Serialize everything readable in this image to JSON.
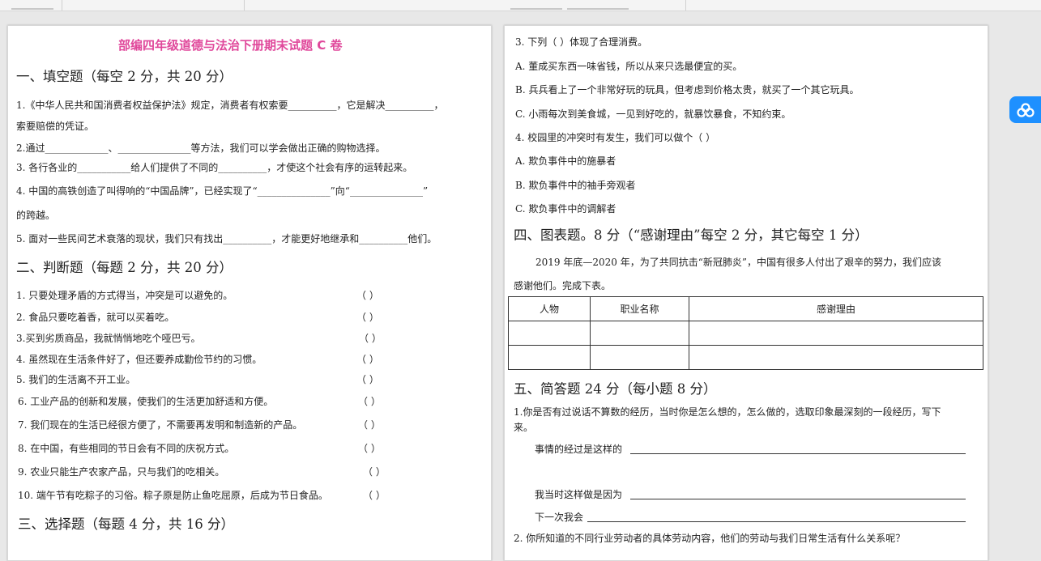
{
  "left": {
    "title": "部编四年级道德与法治下册期末试题 C 卷",
    "s1_heading": "一、填空题（每空 2 分，共 20 分）",
    "fill": [
      "1.《中华人民共和国消费者权益保护法》规定，消费者有权索要__________，它是解决__________，",
      "索要赔偿的凭证。",
      "2.通过_____________、_______________等方法，我们可以学会做出正确的购物选择。",
      "3. 各行各业的___________给人们提供了不同的__________，才使这个社会有序的运转起来。",
      "4. 中国的高铁创造了叫得响的“中国品牌”，已经实现了“_______________”向“_______________”",
      "的跨越。",
      "5. 面对一些民间艺术衰落的现状，我们只有找出__________，才能更好地继承和__________他们。"
    ],
    "s2_heading": "二、判断题（每题 2 分，共 20 分）",
    "judge": [
      {
        "text": "1. 只要处理矛盾的方式得当，冲突是可以避免的。",
        "paren": "（     ）"
      },
      {
        "text": "2. 食品只要吃着香，就可以买着吃。",
        "paren": "（     ）"
      },
      {
        "text": "3.买到劣质商品，我就悄悄地吃个哑巴亏。",
        "paren": "（     ）"
      },
      {
        "text": "4. 虽然现在生活条件好了，但还要养成勤俭节约的习惯。",
        "paren": "（     ）"
      },
      {
        "text": "5. 我们的生活离不开工业。",
        "paren": "（     ）"
      },
      {
        "text": "6. 工业产品的创新和发展，使我们的生活更加舒适和方便。",
        "paren": "（     ）"
      },
      {
        "text": "7. 我们现在的生活已经很方便了，不需要再发明和制造新的产品。",
        "paren": "（     ）"
      },
      {
        "text": "8. 在中国，有些相同的节日会有不同的庆祝方式。",
        "paren": "（     ）"
      },
      {
        "text": "9. 农业只能生产农家产品，只与我们的吃相关。",
        "paren": "（     ）"
      },
      {
        "text": "10. 端午节有吃粽子的习俗。粽子原是防止鱼吃屈原，后成为节日食品。",
        "paren": "（     ）"
      }
    ],
    "s3_heading": "三、选择题（每题 4 分，共 16 分）"
  },
  "right": {
    "choice_lines": [
      "3. 下列（     ）体现了合理消费。",
      "A. 董成买东西一味省钱，所以从来只选最便宜的买。",
      "B. 兵兵看上了一个非常好玩的玩具，但考虑到价格太贵，就买了一个其它玩具。",
      "C. 小雨每次到美食城，一见到好吃的，就暴饮暴食，不知约束。",
      "4. 校园里的冲突时有发生，我们可以做个（     ）",
      "A. 欺负事件中的施暴者",
      "B. 欺负事件中的袖手旁观者",
      "C. 欺负事件中的调解者"
    ],
    "s4_heading": "四、图表题。8 分（“感谢理由”每空 2 分，其它每空 1 分）",
    "s4_intro_1": "2019 年底—2020 年，为了共同抗击“新冠肺炎”，中国有很多人付出了艰辛的努力，我们应该",
    "s4_intro_2": "感谢他们。完成下表。",
    "table_headers": [
      "人物",
      "职业名称",
      "感谢理由"
    ],
    "s5_heading": "五、简答题 24 分（每小题 8 分）",
    "q1_line1": "1.你是否有过说话不算数的经历，当时你是怎么想的，怎么做的，选取印象最深刻的一段经历，写下",
    "q1_line2": "来。",
    "blank1": "事情的经过是这样的",
    "blank2": "我当时这样做是因为",
    "blank3": "下一次我会",
    "q2": "2.  你所知道的不同行业劳动者的具体劳动内容，他们的劳动与我们日常生活有什么关系呢？"
  },
  "sidebar": {
    "button_icon": "cloud-icon",
    "button_color": "#1e90ff"
  },
  "colors": {
    "title": "#e0489b"
  }
}
